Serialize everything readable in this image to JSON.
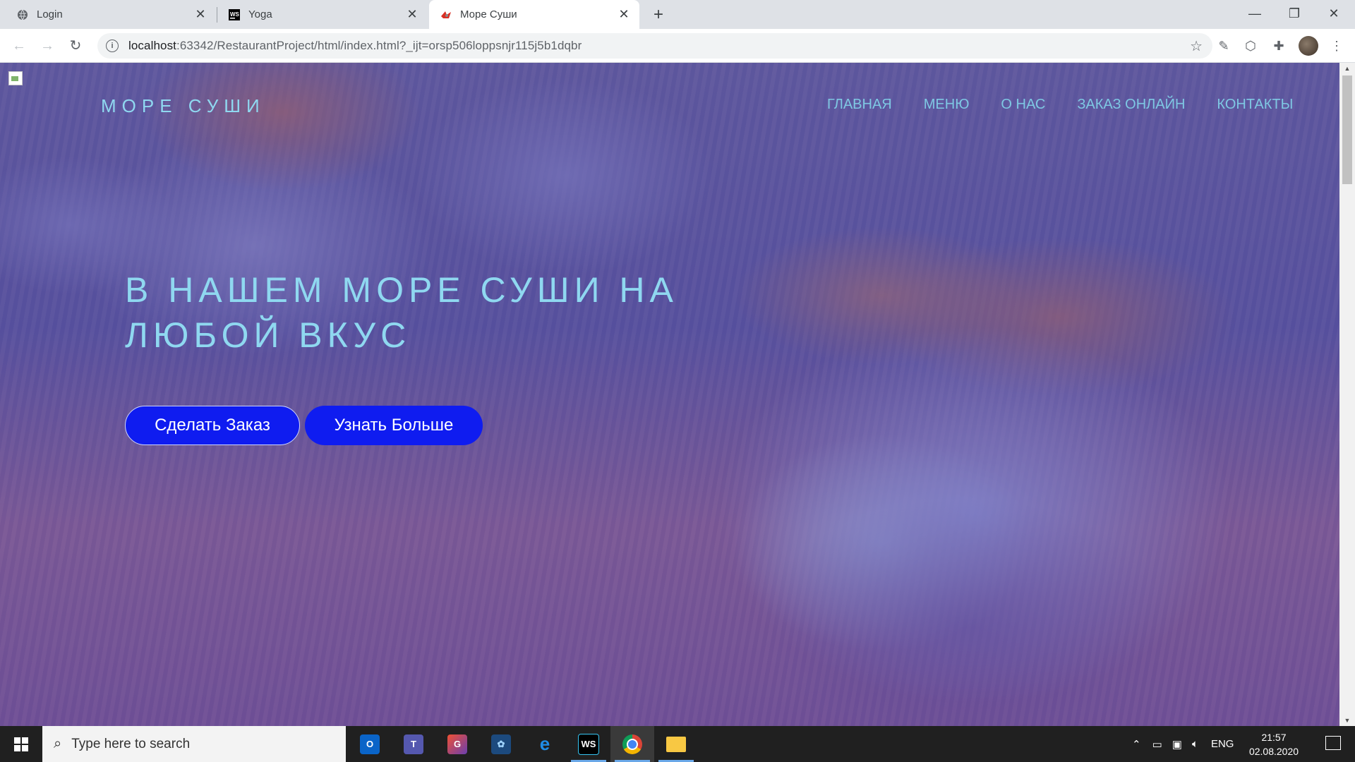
{
  "browser": {
    "tabs": [
      {
        "title": "Login",
        "icon": "globe-icon"
      },
      {
        "title": "Yoga",
        "icon": "webstorm-icon"
      },
      {
        "title": "Море Суши",
        "icon": "sushi-favicon",
        "active": true
      }
    ],
    "url_host": "localhost",
    "url_rest": ":63342/RestaurantProject/html/index.html?_ijt=orsp506loppsnjr115j5b1dqbr"
  },
  "site": {
    "brand": "МОРЕ СУШИ",
    "nav": [
      "ГЛАВНАЯ",
      "МЕНЮ",
      "О НАС",
      "ЗАКАЗ ОНЛАЙН",
      "КОНТАКТЫ"
    ],
    "hero_title": "В НАШЕМ МОРЕ СУШИ НА ЛЮБОЙ ВКУС",
    "btn_order": "Сделать Заказ",
    "btn_more": "Узнать Больше",
    "colors": {
      "accent": "#8fd8f0",
      "button": "#0f1cf0"
    }
  },
  "taskbar": {
    "search_placeholder": "Type here to search",
    "language": "ENG",
    "time": "21:57",
    "date": "02.08.2020",
    "apps": [
      "outlook-icon",
      "teams-icon",
      "git-icon",
      "app-icon",
      "edge-icon",
      "webstorm-icon",
      "chrome-icon",
      "file-explorer-icon"
    ]
  }
}
